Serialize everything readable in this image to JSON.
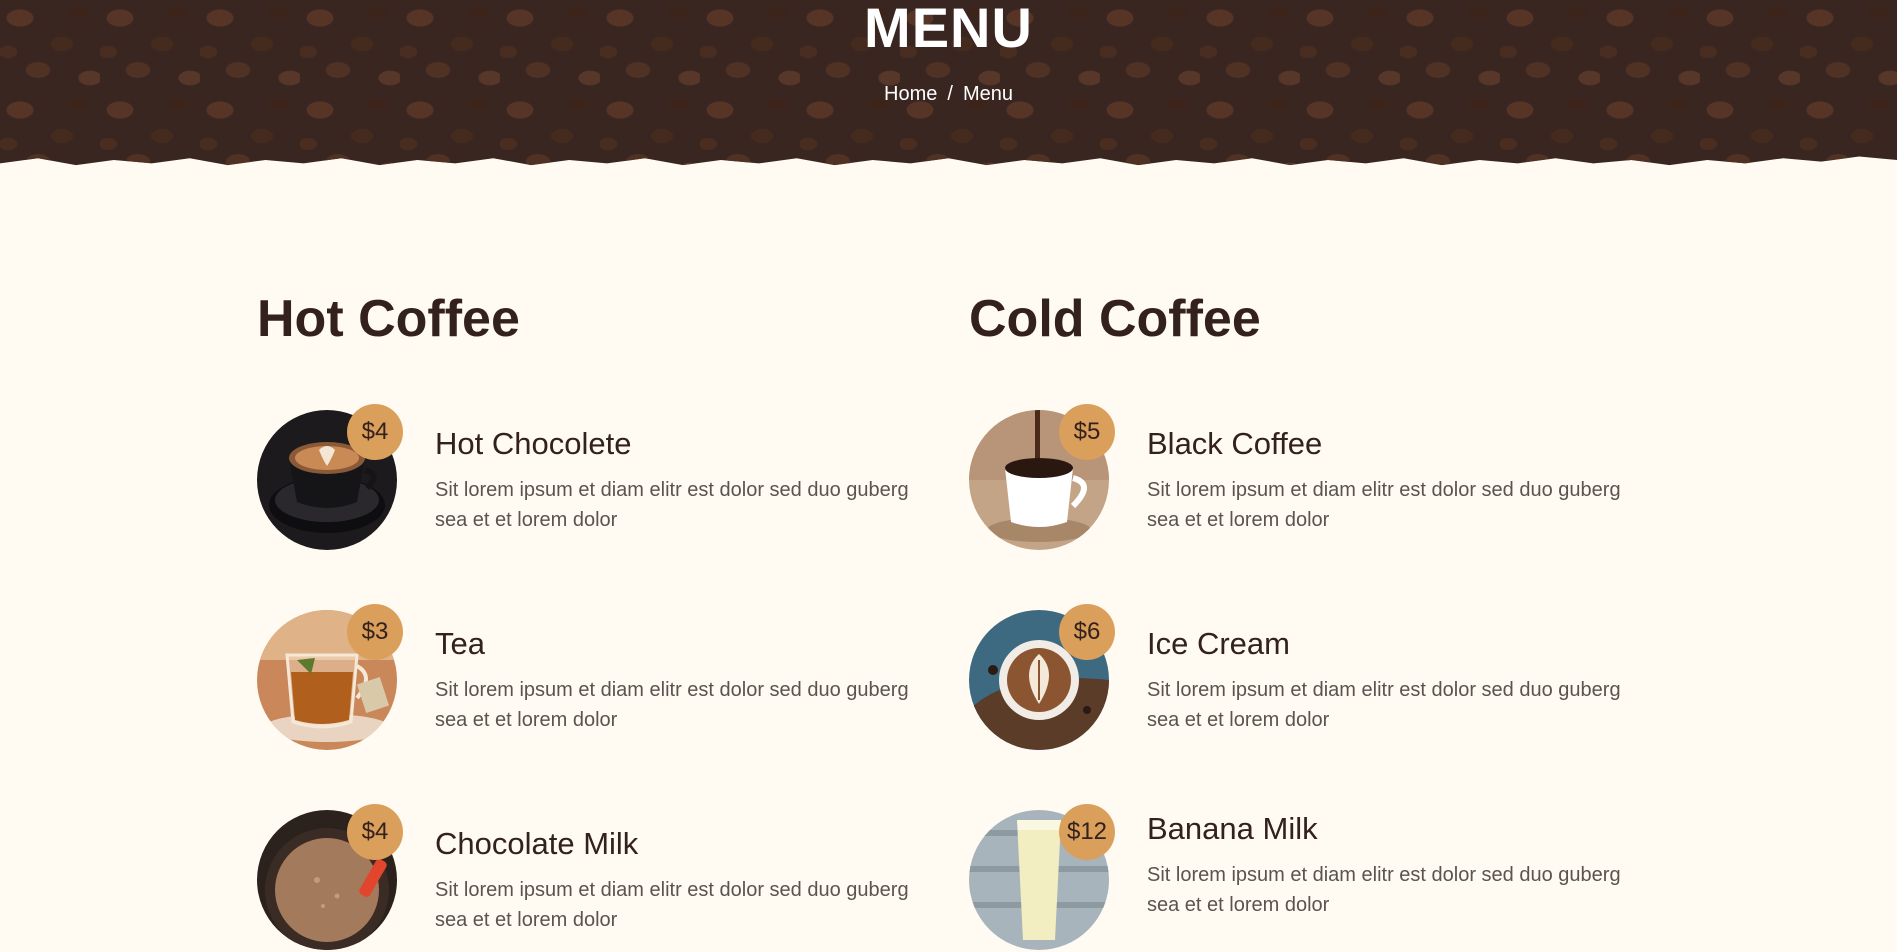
{
  "hero": {
    "title": "MENU",
    "breadcrumb": {
      "home": "Home",
      "separator": "/",
      "current": "Menu"
    }
  },
  "colors": {
    "background": "#FFFBF2",
    "heading": "#33211D",
    "accent": "#DA9F5B",
    "hero_overlay": "#3a2620"
  },
  "menu": {
    "hot": {
      "title": "Hot Coffee",
      "items": [
        {
          "name": "Hot Chocolete",
          "price": "$4",
          "description": "Sit lorem ipsum et diam elitr est dolor sed duo guberg sea et et lorem dolor",
          "icon": "latte-cup-image"
        },
        {
          "name": "Tea",
          "price": "$3",
          "description": "Sit lorem ipsum et diam elitr est dolor sed duo guberg sea et et lorem dolor",
          "icon": "tea-cup-image"
        },
        {
          "name": "Chocolate Milk",
          "price": "$4",
          "description": "Sit lorem ipsum et diam elitr est dolor sed duo guberg sea et et lorem dolor",
          "icon": "chocolate-milk-image"
        }
      ]
    },
    "cold": {
      "title": "Cold Coffee",
      "items": [
        {
          "name": "Black Coffee",
          "price": "$5",
          "description": "Sit lorem ipsum et diam elitr est dolor sed duo guberg sea et et lorem dolor",
          "icon": "black-coffee-image"
        },
        {
          "name": "Ice Cream",
          "price": "$6",
          "description": "Sit lorem ipsum et diam elitr est dolor sed duo guberg sea et et lorem dolor",
          "icon": "latte-art-image"
        },
        {
          "name": "Banana Milk",
          "price": "$12",
          "description": "Sit lorem ipsum et diam elitr est dolor sed duo guberg sea et et lorem dolor",
          "icon": "banana-milk-image"
        }
      ]
    }
  }
}
